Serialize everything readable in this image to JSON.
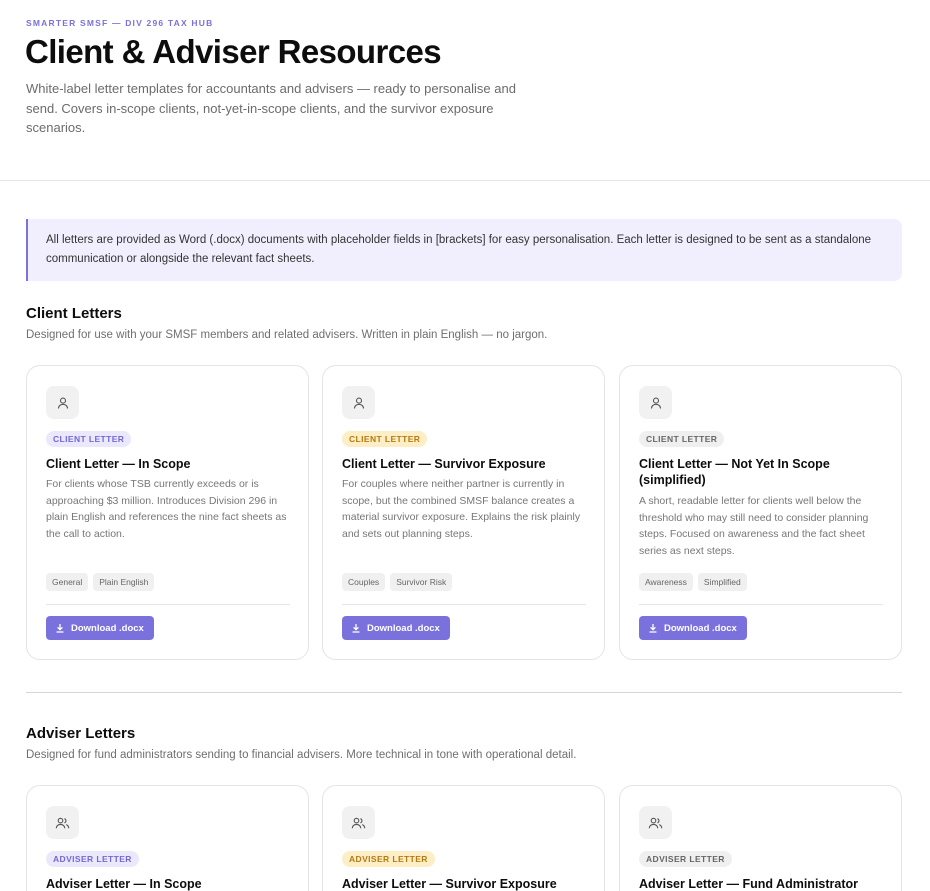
{
  "header": {
    "eyebrow": "SMARTER SMSF — DIV 296 TAX HUB",
    "title": "Client & Adviser Resources",
    "description": "White-label letter templates for accountants and advisers — ready to personalise and send. Covers in-scope clients, not-yet-in-scope clients, and the survivor exposure scenarios."
  },
  "notice": "All letters are provided as Word (.docx) documents with placeholder fields in [brackets] for easy personalisation. Each letter is designed to be sent as a standalone communication or alongside the relevant fact sheets.",
  "client_section": {
    "title": "Client Letters",
    "subtitle": "Designed for use with your SMSF members and related advisers. Written in plain English — no jargon.",
    "cards": [
      {
        "icon": "user-icon",
        "badge": "CLIENT LETTER",
        "badge_color": "#7269d4",
        "title": "Client Letter — In Scope",
        "description": "For clients whose TSB currently exceeds or is approaching $3 million. Introduces Division 296 in plain English and references the nine fact sheets as the call to action.",
        "tags": [
          "General",
          "Plain English"
        ],
        "button": "Download .docx"
      },
      {
        "icon": "user-icon",
        "badge": "CLIENT LETTER",
        "badge_color": "#b57a12",
        "title": "Client Letter — Survivor Exposure",
        "description": "For couples where neither partner is currently in scope, but the combined SMSF balance creates a material survivor exposure. Explains the risk plainly and sets out planning steps.",
        "tags": [
          "Couples",
          "Survivor Risk"
        ],
        "button": "Download .docx"
      },
      {
        "icon": "user-icon",
        "badge": "CLIENT LETTER",
        "badge_color": "#666666",
        "title": "Client Letter — Not Yet In Scope (simplified)",
        "description": "A short, readable letter for clients well below the threshold who may still need to consider planning steps. Focused on awareness and the fact sheet series as next steps.",
        "tags": [
          "Awareness",
          "Simplified"
        ],
        "button": "Download .docx"
      }
    ]
  },
  "adviser_section": {
    "title": "Adviser Letters",
    "subtitle": "Designed for fund administrators sending to financial advisers. More technical in tone with operational detail.",
    "cards": [
      {
        "icon": "users-icon",
        "badge": "ADVISER LETTER",
        "badge_color": "#7269d4",
        "title": "Adviser Letter — In Scope"
      },
      {
        "icon": "users-icon",
        "badge": "ADVISER LETTER",
        "badge_color": "#b57a12",
        "title": "Adviser Letter — Survivor Exposure"
      },
      {
        "icon": "users-icon",
        "badge": "ADVISER LETTER",
        "badge_color": "#666666",
        "title": "Adviser Letter — Fund Administrator"
      }
    ]
  },
  "colors": {
    "accent": "#7b71dc",
    "notice_bg": "#f1effd"
  }
}
